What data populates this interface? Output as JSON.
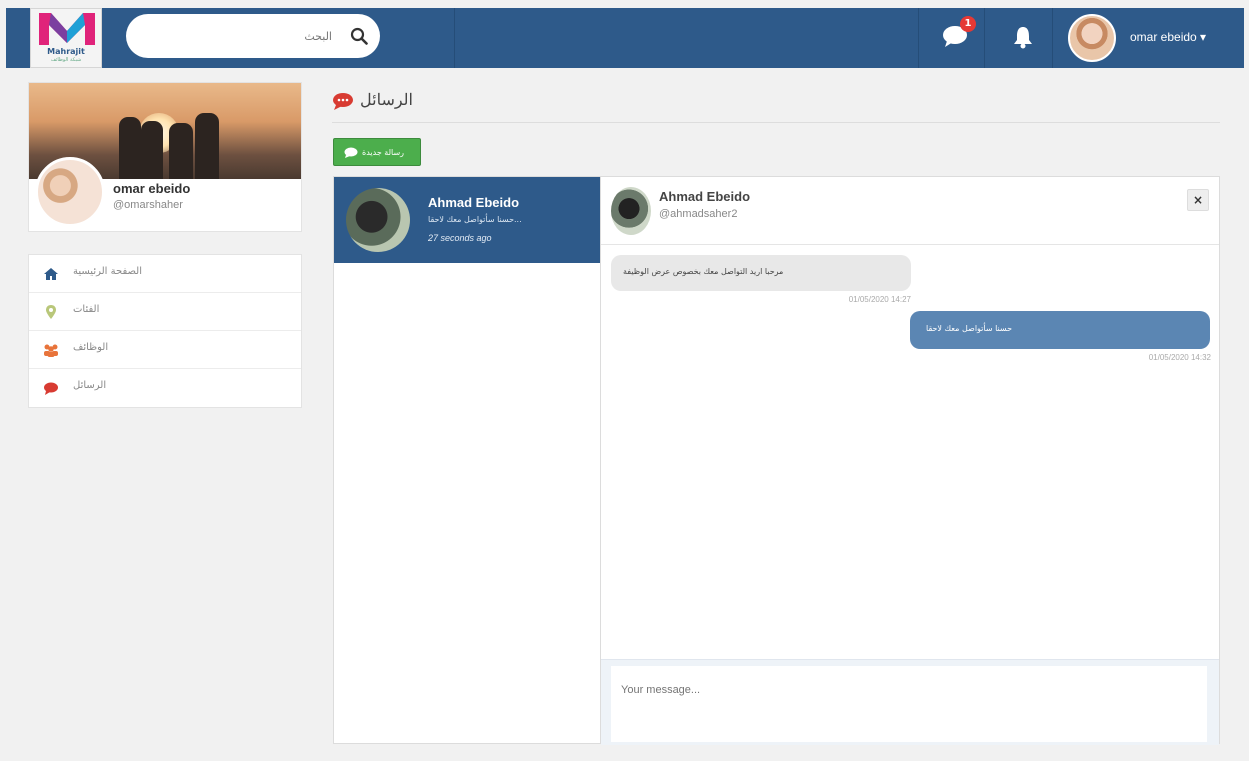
{
  "header": {
    "logo_text": "Mahrajit",
    "logo_sub": "شبكة الوظائف",
    "search_placeholder": "البحث",
    "messages_badge": "1",
    "user_name": "omar ebeido ▾"
  },
  "profile": {
    "name": "omar ebeido",
    "handle": "@omarshaher"
  },
  "sidebar": {
    "items": [
      {
        "label": "الصفحة الرئيسية",
        "icon": "home-icon"
      },
      {
        "label": "الفئات",
        "icon": "map-marker-icon"
      },
      {
        "label": "الوظائف",
        "icon": "users-icon"
      },
      {
        "label": "الرسائل",
        "icon": "comment-icon"
      }
    ]
  },
  "main": {
    "title": "الرسائل",
    "new_message_label": "رسالة جديدة"
  },
  "conversations": [
    {
      "name": "Ahmad Ebeido",
      "preview": "...حسنا سأتواصل معك لاحقا",
      "time": "27 seconds ago"
    }
  ],
  "chat": {
    "name": "Ahmad Ebeido",
    "handle": "@ahmadsaher2",
    "close_label": "×",
    "messages": [
      {
        "text": "مرحبا اريد التواصل معك بخصوص عرض الوظيفة",
        "time": "01/05/2020 14:27",
        "direction": "in"
      },
      {
        "text": "حسنا سأتواصل معك لاحقا",
        "time": "01/05/2020 14:32",
        "direction": "out"
      }
    ],
    "input_placeholder": "Your message..."
  },
  "colors": {
    "primary": "#2e5a8a",
    "accent_green": "#4cae4c",
    "badge_red": "#e53935",
    "bubble_out": "#5b86b3"
  }
}
